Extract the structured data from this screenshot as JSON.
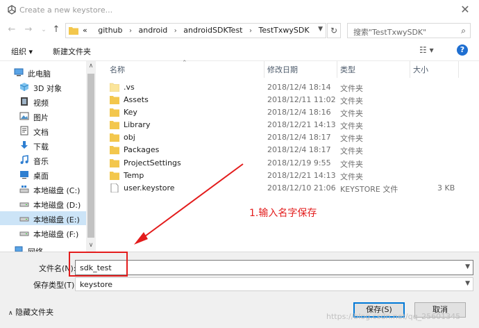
{
  "window": {
    "title": "Create a new keystore..."
  },
  "navigation": {
    "breadcrumb": [
      "github",
      "android",
      "androidSDKTest",
      "TestTxwySDK"
    ],
    "overflow": "«",
    "search_placeholder": "搜索\"TestTxwySDK\""
  },
  "toolbar": {
    "organize": "组织 ▾",
    "new_folder": "新建文件夹"
  },
  "sidebar": {
    "items": [
      {
        "label": "此电脑",
        "icon": "computer-icon"
      },
      {
        "label": "3D 对象",
        "icon": "cube-icon"
      },
      {
        "label": "视频",
        "icon": "video-icon"
      },
      {
        "label": "图片",
        "icon": "image-icon"
      },
      {
        "label": "文档",
        "icon": "document-icon"
      },
      {
        "label": "下载",
        "icon": "download-icon"
      },
      {
        "label": "音乐",
        "icon": "music-icon"
      },
      {
        "label": "桌面",
        "icon": "desktop-icon"
      },
      {
        "label": "本地磁盘 (C:)",
        "icon": "windows-drive-icon"
      },
      {
        "label": "本地磁盘 (D:)",
        "icon": "drive-icon"
      },
      {
        "label": "本地磁盘 (E:)",
        "icon": "drive-icon",
        "selected": true
      },
      {
        "label": "本地磁盘 (F:)",
        "icon": "drive-icon"
      },
      {
        "label": "网络",
        "icon": "network-icon"
      }
    ]
  },
  "file_list": {
    "columns": [
      "名称",
      "修改日期",
      "类型",
      "大小"
    ],
    "rows": [
      {
        "name": ".vs",
        "date": "2018/12/4 18:14",
        "type": "文件夹",
        "size": "",
        "icon": "folder-icon"
      },
      {
        "name": "Assets",
        "date": "2018/12/11 11:02",
        "type": "文件夹",
        "size": "",
        "icon": "folder-icon"
      },
      {
        "name": "Key",
        "date": "2018/12/4 18:16",
        "type": "文件夹",
        "size": "",
        "icon": "folder-icon"
      },
      {
        "name": "Library",
        "date": "2018/12/21 14:13",
        "type": "文件夹",
        "size": "",
        "icon": "folder-icon"
      },
      {
        "name": "obj",
        "date": "2018/12/4 18:17",
        "type": "文件夹",
        "size": "",
        "icon": "folder-icon"
      },
      {
        "name": "Packages",
        "date": "2018/12/4 18:17",
        "type": "文件夹",
        "size": "",
        "icon": "folder-icon"
      },
      {
        "name": "ProjectSettings",
        "date": "2018/12/19 9:55",
        "type": "文件夹",
        "size": "",
        "icon": "folder-icon"
      },
      {
        "name": "Temp",
        "date": "2018/12/21 14:13",
        "type": "文件夹",
        "size": "",
        "icon": "folder-icon"
      },
      {
        "name": "user.keystore",
        "date": "2018/12/10 21:06",
        "type": "KEYSTORE 文件",
        "size": "3 KB",
        "icon": "file-icon"
      }
    ]
  },
  "form": {
    "filename_label": "文件名(N):",
    "filename_value": "sdk_test",
    "filetype_label": "保存类型(T):",
    "filetype_value": "keystore"
  },
  "footer": {
    "hide_folders": "隐藏文件夹",
    "save_label": "保存(S)",
    "cancel_label": "取消"
  },
  "annotation": {
    "text": "1.输入名字保存",
    "color": "#e31c1c"
  },
  "watermark": "https://blog.csdn.net/qq_25601345",
  "colors": {
    "selection": "#cce4f7",
    "folder": "#f3c74d",
    "accent": "#0078d7",
    "annotation": "#e31c1c"
  }
}
